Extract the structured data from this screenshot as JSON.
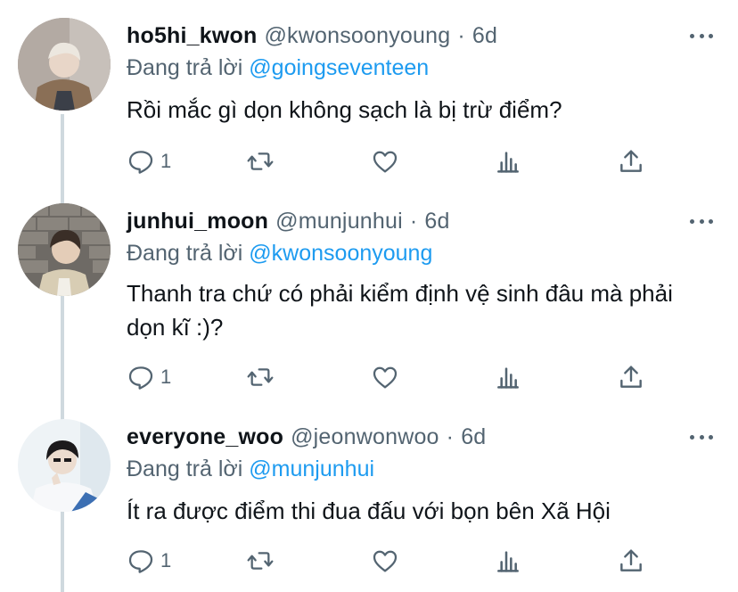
{
  "tweets": [
    {
      "name": "ho5hi_kwon",
      "handle": "@kwonsoonyoung",
      "dot": "·",
      "time": "6d",
      "replying_prefix": "Đang trả lời",
      "replying_to": "@goingseventeen",
      "text": "Rồi mắc gì dọn không sạch là bị trừ điểm?",
      "reply_count": "1"
    },
    {
      "name": "junhui_moon",
      "handle": "@munjunhui",
      "dot": "·",
      "time": "6d",
      "replying_prefix": "Đang trả lời",
      "replying_to": "@kwonsoonyoung",
      "text": "Thanh tra chứ có phải kiểm định vệ sinh đâu mà phải dọn kĩ :)?",
      "reply_count": "1"
    },
    {
      "name": "everyone_woo",
      "handle": "@jeonwonwoo",
      "dot": "·",
      "time": "6d",
      "replying_prefix": "Đang trả lời",
      "replying_to": "@munjunhui",
      "text": "Ít ra được điểm thi đua đấu với bọn bên Xã Hội",
      "reply_count": "1"
    }
  ],
  "icons": {
    "reply": "reply-icon",
    "retweet": "retweet-icon",
    "like": "heart-icon",
    "analytics": "analytics-icon",
    "share": "share-icon",
    "more": "more-icon"
  },
  "colors": {
    "link": "#1d9bf0",
    "secondary": "#536471",
    "primary_text": "#0f1419",
    "thread_line": "#cfd9de"
  }
}
